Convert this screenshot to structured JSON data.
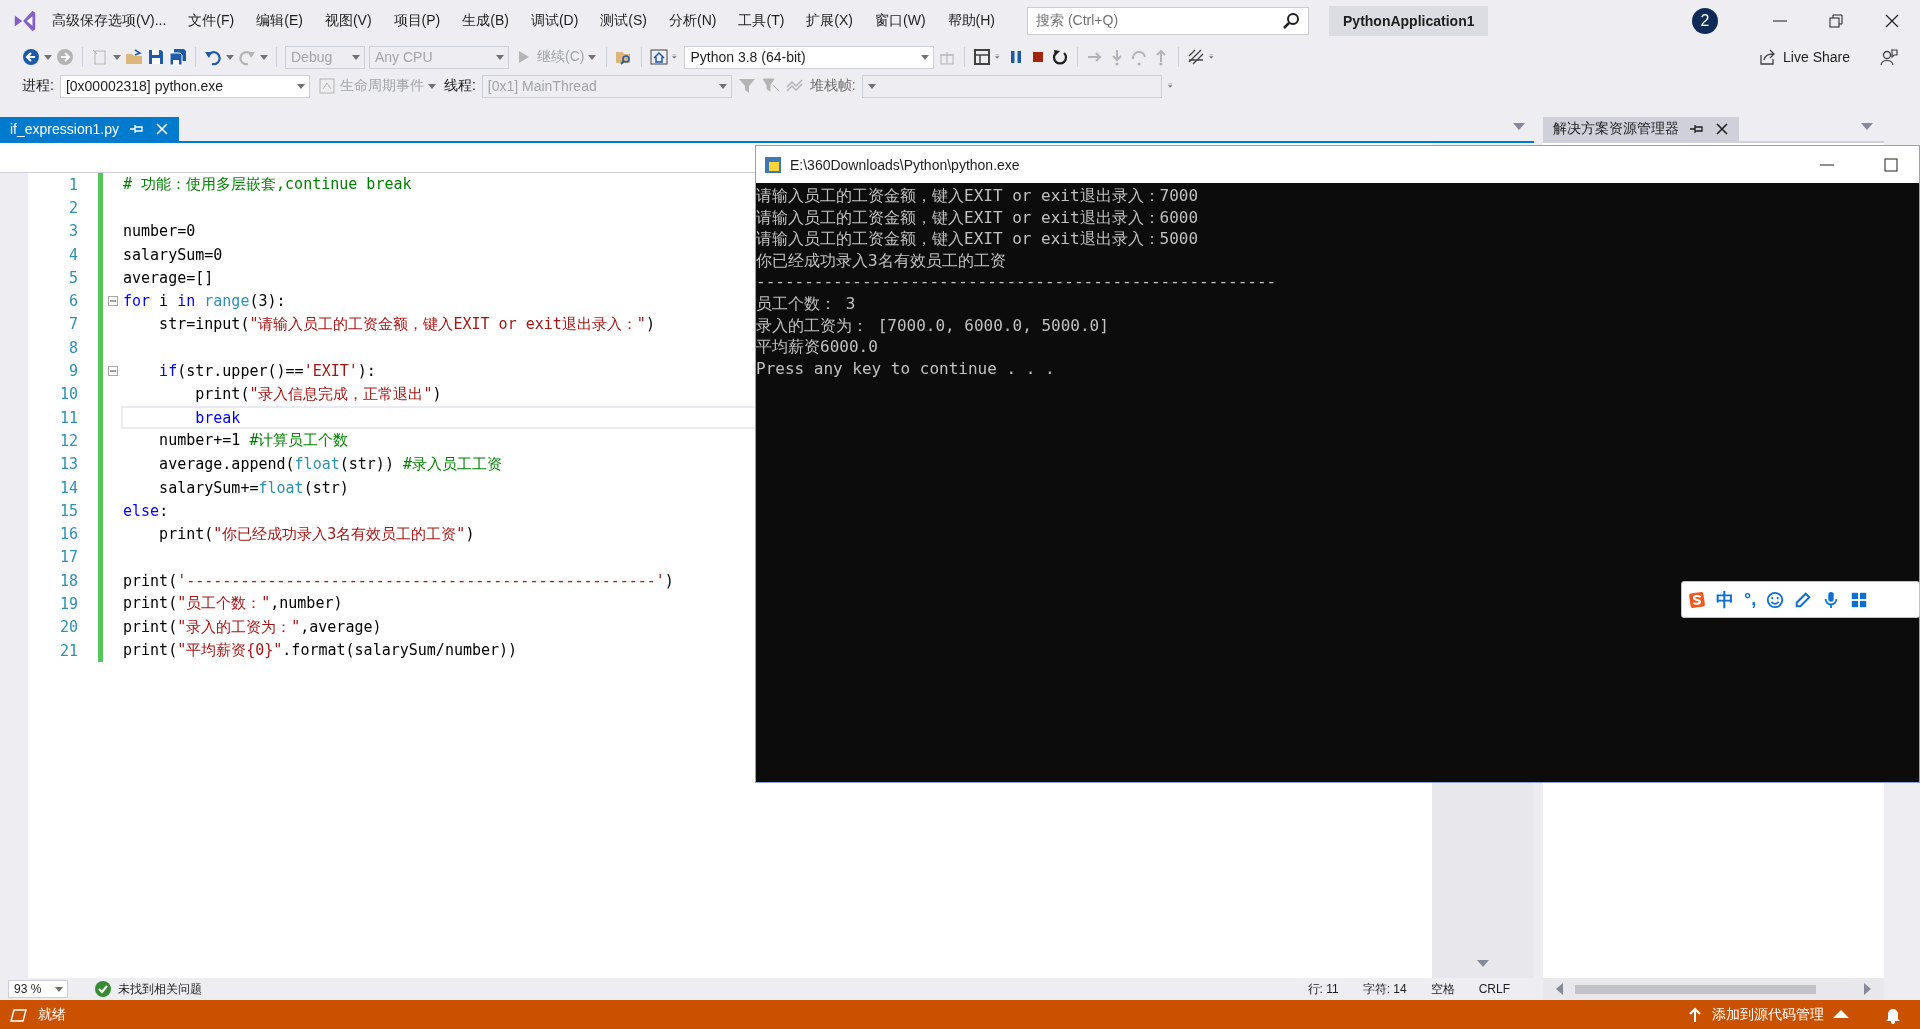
{
  "menu": {
    "items": [
      "高级保存选项(V)...",
      "文件(F)",
      "编辑(E)",
      "视图(V)",
      "项目(P)",
      "生成(B)",
      "调试(D)",
      "测试(S)",
      "分析(N)",
      "工具(T)",
      "扩展(X)",
      "窗口(W)",
      "帮助(H)"
    ]
  },
  "title_bar": {
    "search_placeholder": "搜索 (Ctrl+Q)",
    "project": "PythonApplication1",
    "notifications": "2"
  },
  "toolbar": {
    "configuration": {
      "value": "Debug",
      "disabled": true
    },
    "platform": {
      "value": "Any CPU",
      "disabled": true
    },
    "continue_button": {
      "label": "继续(C)",
      "disabled": true
    },
    "environment": {
      "value": "Python 3.8 (64-bit)",
      "disabled": false
    },
    "live_share": "Live Share"
  },
  "debug_toolbar": {
    "process_label": "进程:",
    "process": {
      "value": "[0x00002318] python.exe",
      "disabled": false
    },
    "lifecycle_button": {
      "label": "生命周期事件",
      "disabled": true
    },
    "thread_label": "线程:",
    "thread": {
      "value": "[0x1] MainThread",
      "disabled": true
    },
    "stack_label": "堆栈帧:",
    "stack": {
      "disabled": true
    }
  },
  "editor_tabs": [
    {
      "label": "if_expression1.py",
      "selected": true
    }
  ],
  "code": {
    "lines": [
      {
        "number": "1",
        "fold": false,
        "current": false,
        "tokens": [
          {
            "kind": "cmt",
            "text": "# 功能：使用多层嵌套,continue break"
          }
        ]
      },
      {
        "number": "2",
        "fold": false,
        "current": false
      },
      {
        "number": "3",
        "fold": false,
        "current": false,
        "tokens": [
          {
            "kind": "plain",
            "text": "number=0"
          }
        ]
      },
      {
        "number": "4",
        "fold": false,
        "current": false,
        "tokens": [
          {
            "kind": "plain",
            "text": "salarySum=0"
          }
        ]
      },
      {
        "number": "5",
        "fold": false,
        "current": false,
        "tokens": [
          {
            "kind": "plain",
            "text": "average=[]"
          }
        ]
      },
      {
        "number": "6",
        "fold": true,
        "current": false,
        "tokens": [
          {
            "kind": "kw",
            "text": "for"
          },
          {
            "kind": "plain",
            "text": " i "
          },
          {
            "kind": "kw",
            "text": "in"
          },
          {
            "kind": "builtin",
            "text": " range"
          },
          {
            "kind": "plain",
            "text": "(3):"
          }
        ]
      },
      {
        "number": "7",
        "fold": false,
        "current": false,
        "tokens": [
          {
            "kind": "plain",
            "text": "    str=input("
          },
          {
            "kind": "str",
            "text": "\"请输入员工的工资金额，键入EXIT or exit退出录入：\""
          },
          {
            "kind": "plain",
            "text": ")"
          }
        ]
      },
      {
        "number": "8",
        "fold": false,
        "current": false
      },
      {
        "number": "9",
        "fold": true,
        "current": false,
        "tokens": [
          {
            "kind": "kw",
            "text": "    if"
          },
          {
            "kind": "plain",
            "text": "(str.upper()=="
          },
          {
            "kind": "str",
            "text": "'EXIT'"
          },
          {
            "kind": "plain",
            "text": "):"
          }
        ]
      },
      {
        "number": "10",
        "fold": false,
        "current": false,
        "tokens": [
          {
            "kind": "plain",
            "text": "        print("
          },
          {
            "kind": "str",
            "text": "\"录入信息完成，正常退出\""
          },
          {
            "kind": "plain",
            "text": ")"
          }
        ]
      },
      {
        "number": "11",
        "fold": false,
        "current": true,
        "tokens": [
          {
            "kind": "kw",
            "text": "        break"
          }
        ]
      },
      {
        "number": "12",
        "fold": false,
        "current": false,
        "tokens": [
          {
            "kind": "plain",
            "text": "    number+=1 "
          },
          {
            "kind": "cmt",
            "text": "#计算员工个数"
          }
        ]
      },
      {
        "number": "13",
        "fold": false,
        "current": false,
        "tokens": [
          {
            "kind": "plain",
            "text": "    average.append("
          },
          {
            "kind": "builtin",
            "text": "float"
          },
          {
            "kind": "plain",
            "text": "(str)) "
          },
          {
            "kind": "cmt",
            "text": "#录入员工工资"
          }
        ]
      },
      {
        "number": "14",
        "fold": false,
        "current": false,
        "tokens": [
          {
            "kind": "plain",
            "text": "    salarySum+="
          },
          {
            "kind": "builtin",
            "text": "float"
          },
          {
            "kind": "plain",
            "text": "(str)"
          }
        ]
      },
      {
        "number": "15",
        "fold": false,
        "current": false,
        "tokens": [
          {
            "kind": "kw",
            "text": "else"
          },
          {
            "kind": "plain",
            "text": ":"
          }
        ]
      },
      {
        "number": "16",
        "fold": false,
        "current": false,
        "tokens": [
          {
            "kind": "plain",
            "text": "    print("
          },
          {
            "kind": "str",
            "text": "\"你已经成功录入3名有效员工的工资\""
          },
          {
            "kind": "plain",
            "text": ")"
          }
        ]
      },
      {
        "number": "17",
        "fold": false,
        "current": false
      },
      {
        "number": "18",
        "fold": false,
        "current": false,
        "tokens": [
          {
            "kind": "plain",
            "text": "print("
          },
          {
            "kind": "str",
            "text": "'----------------------------------------------------'"
          },
          {
            "kind": "plain",
            "text": ")"
          }
        ]
      },
      {
        "number": "19",
        "fold": false,
        "current": false,
        "tokens": [
          {
            "kind": "plain",
            "text": "print("
          },
          {
            "kind": "str",
            "text": "\"员工个数：\""
          },
          {
            "kind": "plain",
            "text": ",number)"
          }
        ]
      },
      {
        "number": "20",
        "fold": false,
        "current": false,
        "tokens": [
          {
            "kind": "plain",
            "text": "print("
          },
          {
            "kind": "str",
            "text": "\"录入的工资为：\""
          },
          {
            "kind": "plain",
            "text": ",average)"
          }
        ]
      },
      {
        "number": "21",
        "fold": false,
        "current": false,
        "tokens": [
          {
            "kind": "plain",
            "text": "print("
          },
          {
            "kind": "str",
            "text": "\"平均薪资{0}\""
          },
          {
            "kind": "plain",
            "text": ".format(salarySum/number))"
          }
        ]
      }
    ]
  },
  "editor_status": {
    "zoom": "93 %",
    "issues": "未找到相关问题",
    "line": "行: 11",
    "char": "字符: 14",
    "indent": "空格",
    "line_ending": "CRLF"
  },
  "side_panel": {
    "tab": {
      "label": "解决方案资源管理器",
      "selected": false
    }
  },
  "console": {
    "title": "E:\\360Downloads\\Python\\python.exe",
    "lines": [
      "请输入员工的工资金额，键入EXIT or exit退出录入：7000",
      "请输入员工的工资金额，键入EXIT or exit退出录入：6000",
      "请输入员工的工资金额，键入EXIT or exit退出录入：5000",
      "你已经成功录入3名有效员工的工资",
      "------------------------------------------------------",
      "员工个数： 3",
      "录入的工资为： [7000.0, 6000.0, 5000.0]",
      "平均薪资6000.0",
      "Press any key to continue . . ."
    ]
  },
  "ime": {
    "mode": "中",
    "punctuation": "°,"
  },
  "status_bar": {
    "state": "就绪",
    "source_control": "添加到源代码管理"
  }
}
